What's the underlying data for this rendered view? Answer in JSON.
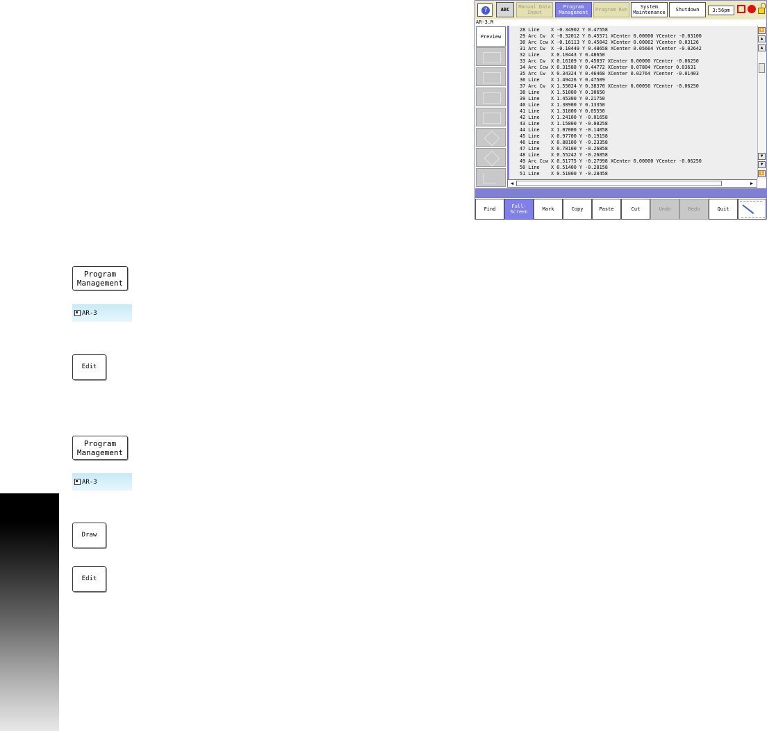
{
  "screen": {
    "help_label": "?",
    "top_buttons": [
      "ABC",
      "Manual Data\nInput",
      "Program\nManagement",
      "Program Run",
      "System\nMaintenance",
      "Shutdown"
    ],
    "time": "3:56pm",
    "file_title": "AR-3.M",
    "preview_label": "Preview",
    "program_lines": [
      "28 Line    X -0.34902 Y 0.47558",
      "29 Arc Cw  X -0.32012 Y 0.45571 XCenter 0.00000 YCenter -0.03100",
      "30 Arc Ccw X -0.16113 Y 0.45042 XCenter 0.00062 YCenter 0.03126",
      "31 Arc Cw  X -0.10449 Y 0.48658 XCenter 0.05664 YCenter -0.02642",
      "32 Line    X 0.10443 Y 0.48650",
      "33 Arc Cw  X 0.16109 Y 0.45037 XCenter 0.00000 YCenter -0.06250",
      "34 Arc Ccw X 0.31588 Y 0.44772 XCenter 0.07804 YCenter 0.03631",
      "35 Arc Cw  X 0.34324 Y 0.46468 XCenter 0.02764 YCenter -0.01403",
      "36 Line    X 1.49426 Y 0.47509",
      "37 Arc Cw  X 1.55024 Y 0.38370 XCenter 0.00056 YCenter -0.06250",
      "38 Line    X 1.51000 Y 0.30650",
      "39 Line    X 1.45300 Y 0.21750",
      "40 Line    X 1.38900 Y 0.13350",
      "41 Line    X 1.31800 Y 0.05550",
      "42 Line    X 1.24100 Y -0.01658",
      "43 Line    X 1.15800 Y -0.08258",
      "44 Line    X 1.07000 Y -0.14058",
      "45 Line    X 0.97700 Y -0.19158",
      "46 Line    X 0.88100 Y -0.23358",
      "47 Line    X 0.78100 Y -0.26858",
      "48 Line    X 0.55242 Y -0.26858",
      "49 Arc Ccw X 0.51775 Y -0.27998 XCenter 0.00000 YCenter -0.06250",
      "50 Line    X 0.51400 Y -0.28158",
      "51 Line    X 0.51000 Y -0.28458"
    ],
    "bottom_buttons": [
      "Find",
      "Full-\nScreen",
      "Mark",
      "Copy",
      "Paste",
      "Cut",
      "Undo",
      "Redo",
      "Quit"
    ]
  },
  "steps": {
    "program_management": "Program\nManagement",
    "file_name": "AR-3",
    "edit": "Edit",
    "draw": "Draw"
  }
}
